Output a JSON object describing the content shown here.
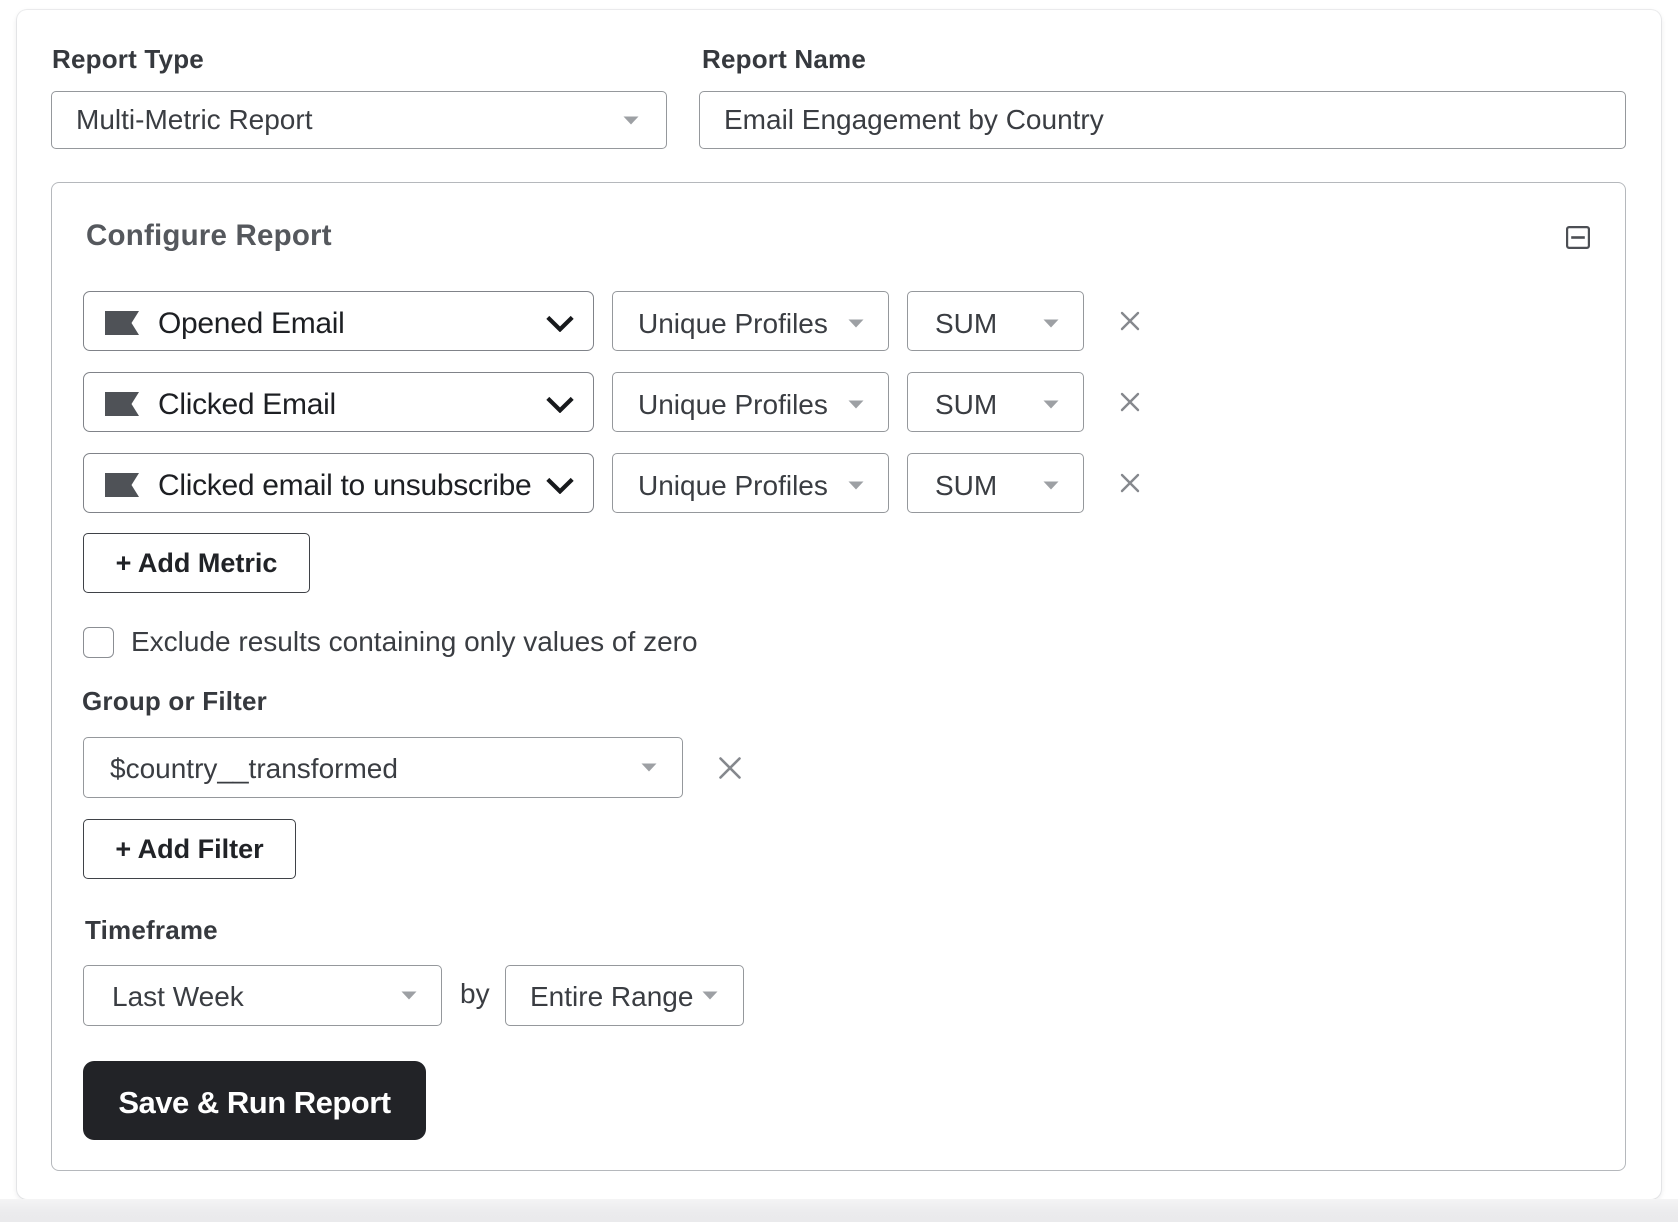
{
  "report_type": {
    "label": "Report Type",
    "value": "Multi-Metric Report"
  },
  "report_name": {
    "label": "Report Name",
    "value": "Email Engagement by Country"
  },
  "configure": {
    "title": "Configure Report",
    "metrics": [
      {
        "name": "Opened Email",
        "measurement": "Unique Profiles",
        "aggregation": "SUM"
      },
      {
        "name": "Clicked Email",
        "measurement": "Unique Profiles",
        "aggregation": "SUM"
      },
      {
        "name": "Clicked email to unsubscribe",
        "measurement": "Unique Profiles",
        "aggregation": "SUM"
      }
    ],
    "add_metric_label": "+ Add Metric",
    "exclude_zero_label": "Exclude results containing only values of zero",
    "exclude_zero_checked": false,
    "group_or_filter": {
      "label": "Group or Filter",
      "value": "$country__transformed"
    },
    "add_filter_label": "+ Add Filter",
    "timeframe": {
      "label": "Timeframe",
      "value": "Last Week",
      "by_label": "by",
      "interval": "Entire Range"
    },
    "save_label": "Save & Run Report"
  },
  "colors": {
    "save_button_bg": "#1e1f22",
    "panel_border": "#b5b8bc",
    "input_border": "#95989c",
    "flag_icon": "#4b4e54",
    "caret": "#9da0a4",
    "x_icon": "#85888d"
  }
}
